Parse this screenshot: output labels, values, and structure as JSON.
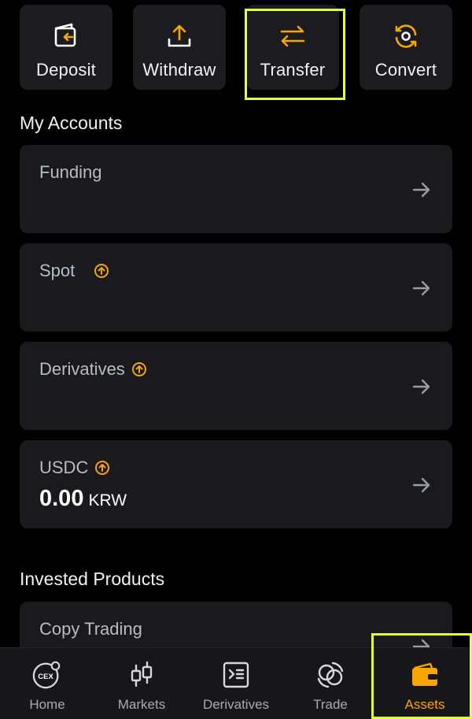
{
  "actions": [
    {
      "label": "Deposit",
      "icon": "deposit-icon"
    },
    {
      "label": "Withdraw",
      "icon": "upload-icon"
    },
    {
      "label": "Transfer",
      "icon": "swap-arrows-icon"
    },
    {
      "label": "Convert",
      "icon": "convert-icon"
    }
  ],
  "my_accounts": {
    "title": "My Accounts",
    "items": [
      {
        "name": "Funding"
      },
      {
        "name": "Spot"
      },
      {
        "name": "Derivatives"
      },
      {
        "name": "USDC",
        "amount": "0.00",
        "currency": "KRW"
      }
    ]
  },
  "invested": {
    "title": "Invested Products",
    "items": [
      {
        "name": "Copy Trading"
      }
    ]
  },
  "tabbar": {
    "items": [
      {
        "label": "Home",
        "icon": "cex-icon"
      },
      {
        "label": "Markets",
        "icon": "candlestick-icon"
      },
      {
        "label": "Derivatives",
        "icon": "terminal-icon"
      },
      {
        "label": "Trade",
        "icon": "trade-icon"
      },
      {
        "label": "Assets",
        "icon": "wallet-icon",
        "active": true
      }
    ]
  },
  "colors": {
    "accent": "#f7a600",
    "highlight": "#e4ff3a",
    "card": "#1a1a1e",
    "background": "#000000"
  }
}
